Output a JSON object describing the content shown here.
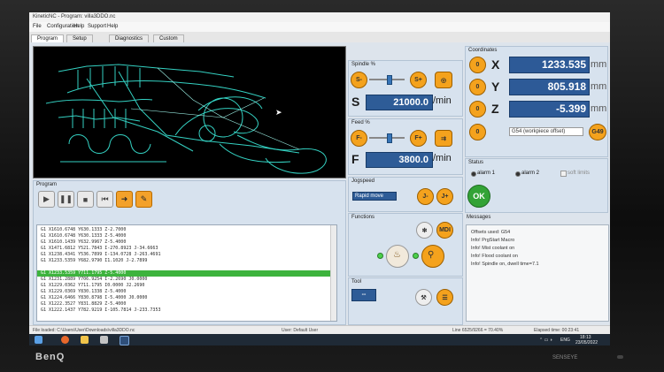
{
  "window": {
    "title": "KineticNC - Program: villa3DDO.nc"
  },
  "menu": [
    "File",
    "Configuration",
    "Help",
    "Support",
    "Help"
  ],
  "tabs": [
    {
      "label": "Program"
    },
    {
      "label": "Setup"
    },
    {
      "label": "Diagnostics"
    },
    {
      "label": "Custom"
    }
  ],
  "program": {
    "title": "Program",
    "lines": [
      "G1 X1610.6748 Y630.1333 Z-2.7000",
      "G1 X1610.6748 Y630.1333 Z-5.4000",
      "G1 X1610.1439 Y632.9967 Z-5.4000",
      "G1 X1471.6812 Y521.7843 I-270.8923 J-34.6663",
      "G1 X1238.4341 Y536.7899 I-134.0728 J-263.4691",
      "G1 X1233.5359 Y682.9790 I1.1020 J-2.7899",
      "G1 X1233.5359 Y711.1795 Z-5.4000",
      "G1 X1231.2889 Y706.9254 I-2.2690 J0.0000",
      "G1 X1229.0362 Y711.1795 I0.0000 J2.2690",
      "G1 X1229.0369 Y830.1338 Z-5.4000",
      "G1 X1224.6466 Y830.8798 I-5.4000 J0.0000",
      "G1 X1222.3527 Y831.8829 Z-5.4000",
      "G1 X1222.1437 Y782.9219 I-105.7814 J-233.7353"
    ],
    "current_line": 6
  },
  "spindle": {
    "title": "Spindle %",
    "label": "S",
    "value": "21000.0",
    "unit": "/min",
    "minus": "S-",
    "plus": "S+",
    "level_pct": 55
  },
  "feed": {
    "title": "Feed %",
    "label": "F",
    "value": "3800.0",
    "unit": "/min",
    "minus": "F-",
    "plus": "F+",
    "level_pct": 55
  },
  "jog": {
    "title": "Jogspeed",
    "mode": "Rapid move",
    "minus": "J-",
    "plus": "J+"
  },
  "functions": {
    "title": "Functions",
    "mdi": "MDI"
  },
  "tool": {
    "title": "Tool",
    "value": "--"
  },
  "coordinates": {
    "title": "Coordinates",
    "axes": [
      {
        "label": "X",
        "value": "1233.535",
        "unit": "mm"
      },
      {
        "label": "Y",
        "value": "805.918",
        "unit": "mm"
      },
      {
        "label": "Z",
        "value": "-5.399",
        "unit": "mm"
      }
    ],
    "zero": "0",
    "offset": "G54 (workpiece offset)",
    "offset_btn": "G49"
  },
  "status": {
    "title": "Status",
    "alarm1": "alarm 1",
    "alarm2": "alarm 2",
    "softlimits": "soft limits",
    "ok": "OK"
  },
  "messages": {
    "title": "Messages",
    "items": [
      "Offsets used: G54",
      "Info! PrgStart Macro",
      "Info! Mist coolant on",
      "Info! Flood coolant on",
      "Info! Spindle on, dwell time=7.1"
    ]
  },
  "statusbar": {
    "file": "File loaded: C:\\Users\\User\\Downloads\\villa3DDO.nc",
    "user": "User: Default User",
    "line": "Line 6525/9266 = 70.40%",
    "elapsed": "Elapsed time: 00:23:41"
  },
  "taskbar": {
    "lang": "ENG",
    "time": "18:13",
    "date": "23/05/2022"
  },
  "bezel": {
    "brand": "BenQ",
    "model": "SENSEYE"
  }
}
